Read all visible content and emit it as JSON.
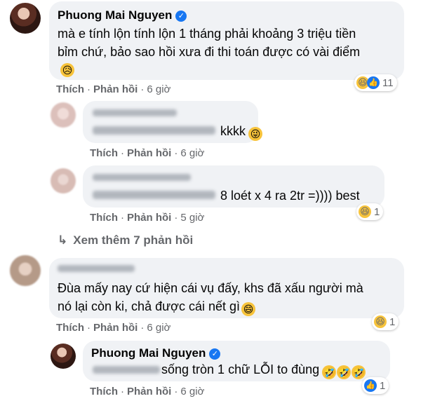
{
  "comments": [
    {
      "author": "Phuong Mai Nguyen",
      "verified": true,
      "text_lines": [
        "mà e tính lộn tính lộn 1 tháng phải khoảng 3 triệu tiền",
        "bỉm chứ, bảo sao hồi xưa đi thi toán được có vài điểm"
      ],
      "text_emoji": "😥",
      "actions": {
        "like": "Thích",
        "reply": "Phản hồi",
        "time": "6 giờ"
      },
      "reactions": {
        "icons": [
          "haha-icon",
          "like-icon"
        ],
        "count": "11"
      }
    },
    {
      "author": "",
      "text": "kkkk",
      "text_emoji": "😜",
      "actions": {
        "like": "Thích",
        "reply": "Phản hồi",
        "time": "6 giờ"
      }
    },
    {
      "author": "",
      "text": "8 loét x 4 ra 2tr =)))) best",
      "actions": {
        "like": "Thích",
        "reply": "Phản hồi",
        "time": "5 giờ"
      },
      "reactions": {
        "icons": [
          "haha-icon"
        ],
        "count": "1"
      }
    }
  ],
  "view_more": {
    "icon": "reply-arrow-icon",
    "label": "Xem thêm 7 phản hồi"
  },
  "second_thread": [
    {
      "author": "",
      "text_lines": [
        "Đùa mấy nay cứ hiện cái vụ đấy, khs đã xấu người mà",
        "nó lại còn ki, chả được cái nết gì"
      ],
      "text_emoji": "😄",
      "actions": {
        "like": "Thích",
        "reply": "Phản hồi",
        "time": "6 giờ"
      },
      "reactions": {
        "icons": [
          "haha-icon"
        ],
        "count": "1"
      }
    },
    {
      "author": "Phuong Mai Nguyen",
      "verified": true,
      "text": "sống tròn 1 chữ LỖI to đùng",
      "text_emojis": [
        "🤣",
        "🤣",
        "🤣"
      ],
      "actions": {
        "like": "Thích",
        "reply": "Phản hồi",
        "time": "6 giờ"
      },
      "reactions": {
        "icons": [
          "like-icon"
        ],
        "count": "1"
      }
    }
  ],
  "colors": {
    "bubble": "#f0f2f5",
    "meta": "#65676b",
    "verified": "#1877f2"
  }
}
